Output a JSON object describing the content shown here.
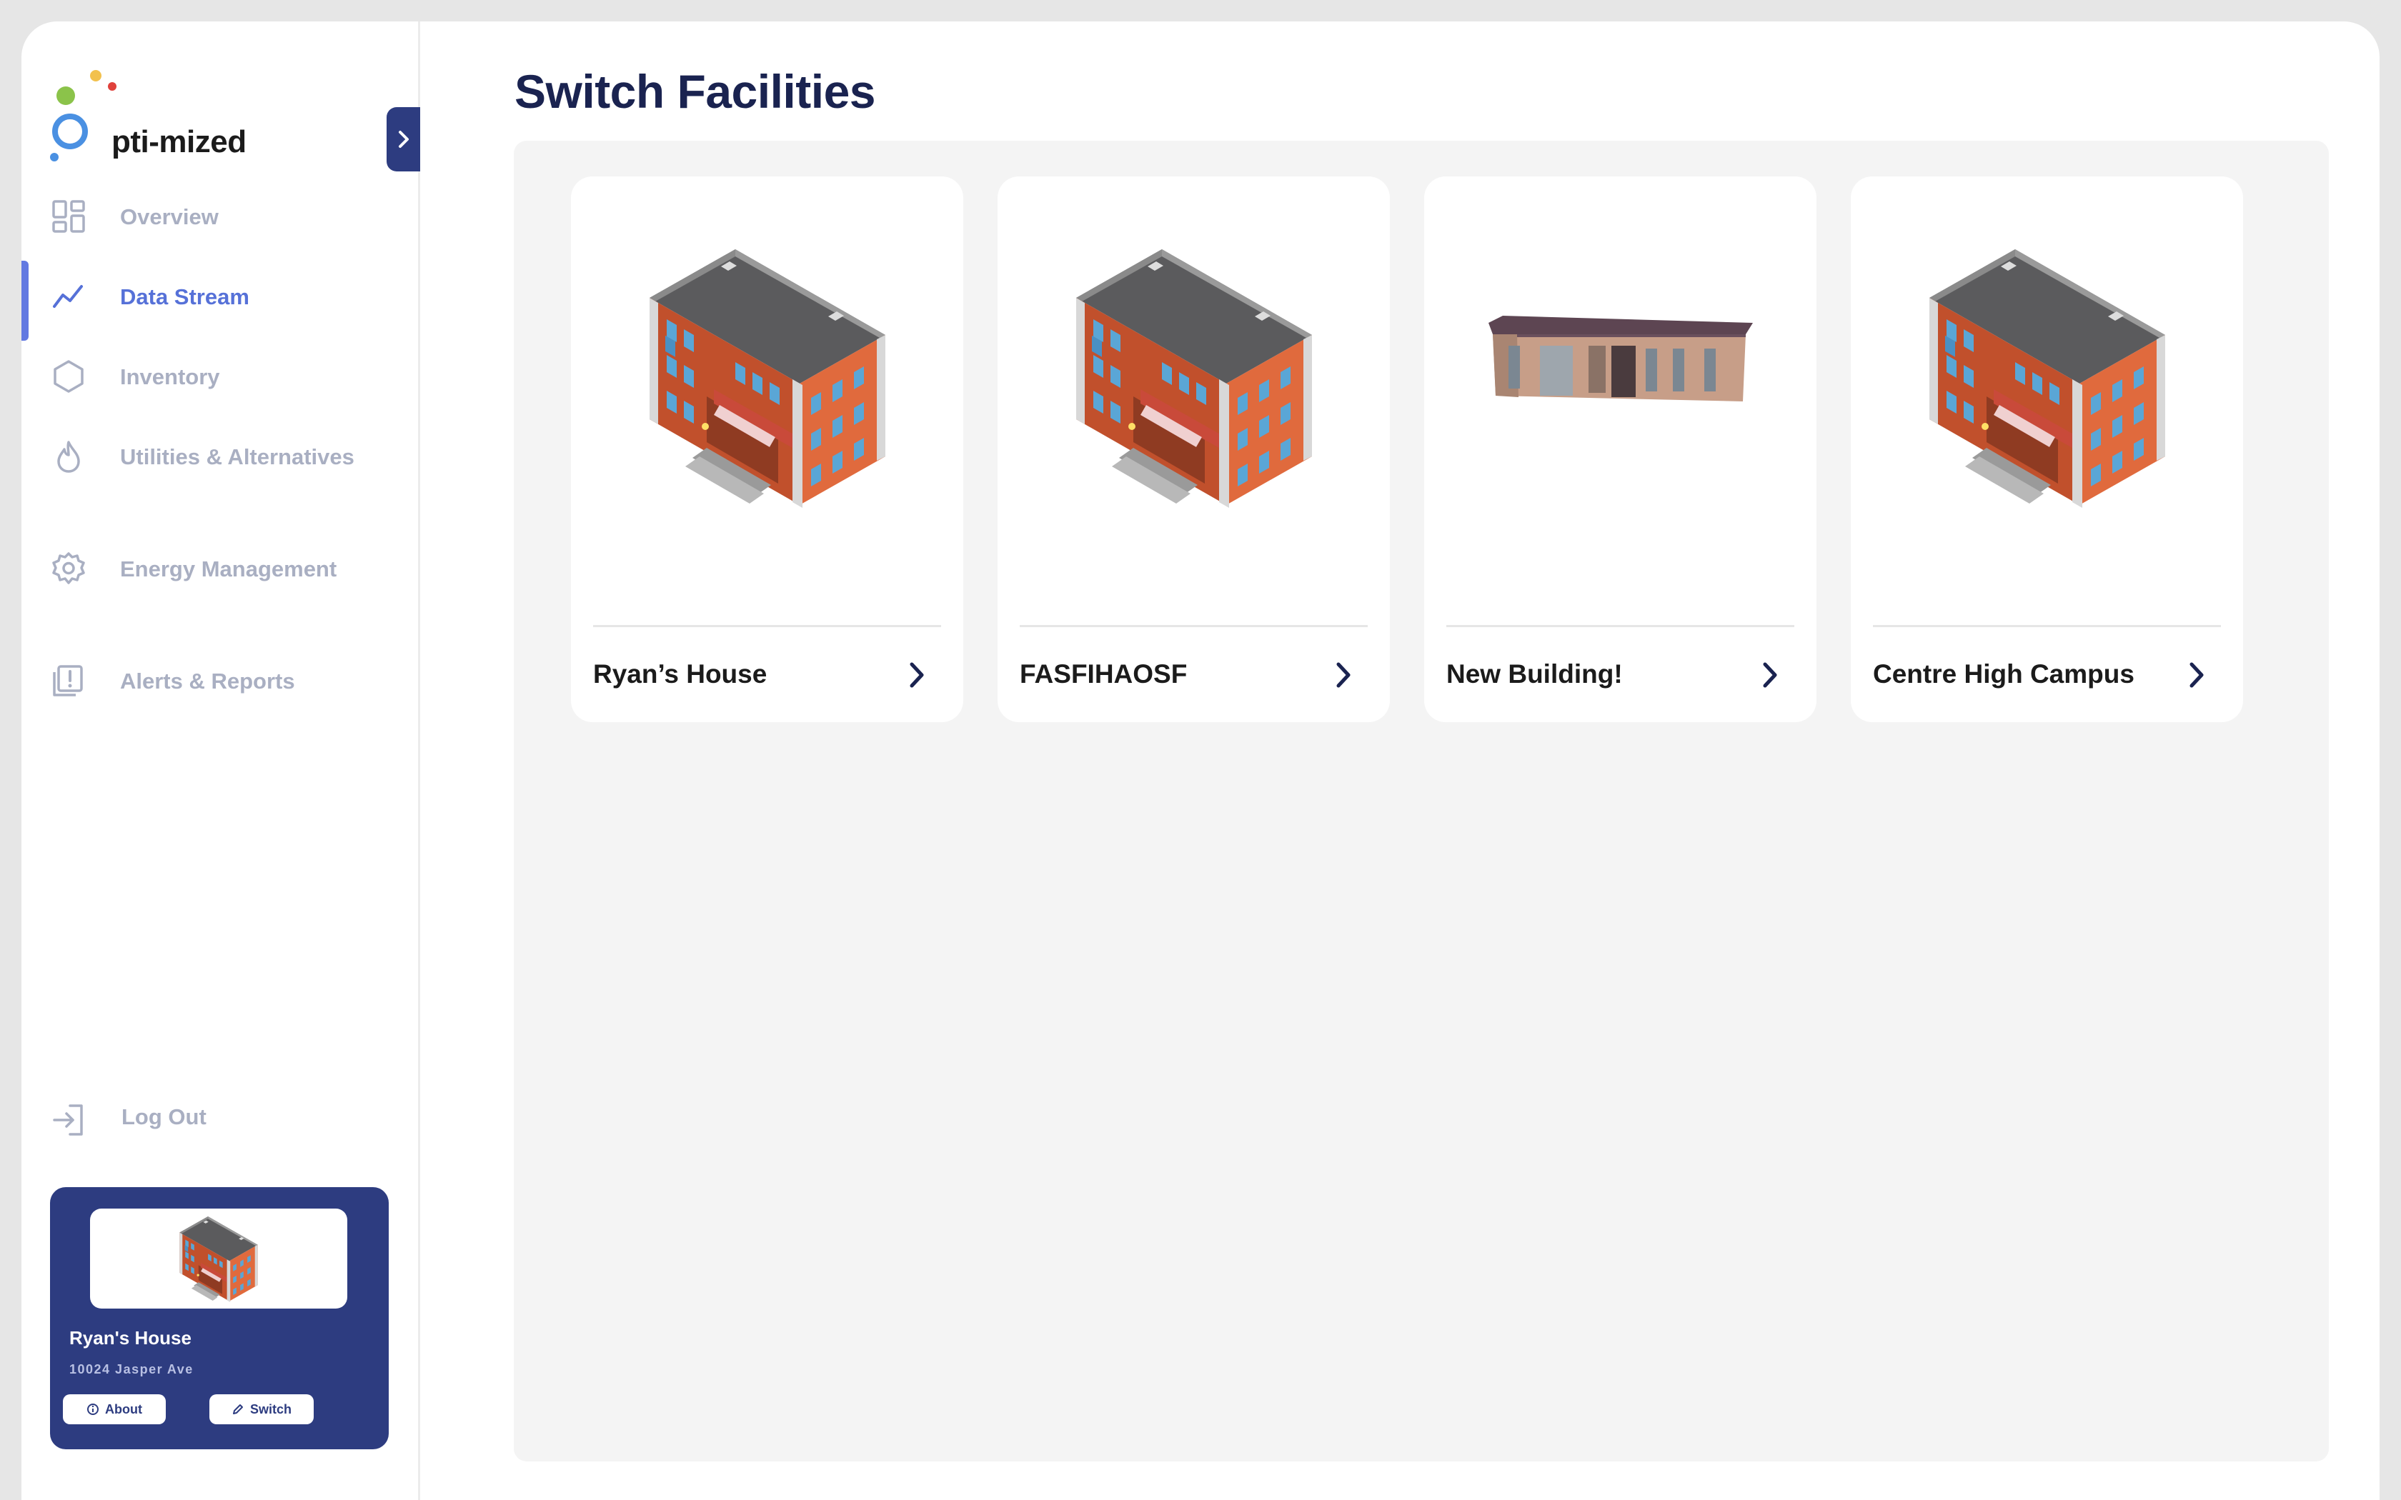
{
  "app": {
    "logo_text": "pti-mized",
    "brand_colors": {
      "primary": "#2d3c80",
      "accent": "#6279e1",
      "dot_green": "#8bc34a",
      "dot_yellow": "#f2c14e",
      "dot_red": "#e0413b",
      "dot_blue": "#4a90e2"
    }
  },
  "sidebar": {
    "collapse_icon": "chevron-right-icon",
    "items": [
      {
        "label": "Overview",
        "icon": "grid-icon",
        "active": false
      },
      {
        "label": "Data Stream",
        "icon": "trend-line-icon",
        "active": true
      },
      {
        "label": "Inventory",
        "icon": "hexagon-icon",
        "active": false
      },
      {
        "label": "Utilities & Alternatives",
        "icon": "flame-icon",
        "active": false
      },
      {
        "label": "Energy Management",
        "icon": "gear-icon",
        "active": false
      },
      {
        "label": "Alerts & Reports",
        "icon": "alert-report-icon",
        "active": false
      }
    ],
    "logout_label": "Log Out",
    "current_facility": {
      "name": "Ryan's House",
      "address": "10024 Jasper Ave",
      "about_label": "About",
      "switch_label": "Switch"
    }
  },
  "main": {
    "title": "Switch Facilities",
    "facilities": [
      {
        "name": "Ryan’s House",
        "image": "school-building"
      },
      {
        "name": "FASFIHAOSF",
        "image": "school-building"
      },
      {
        "name": "New Building!",
        "image": "low-building"
      },
      {
        "name": "Centre High Campus",
        "image": "school-building"
      }
    ]
  }
}
